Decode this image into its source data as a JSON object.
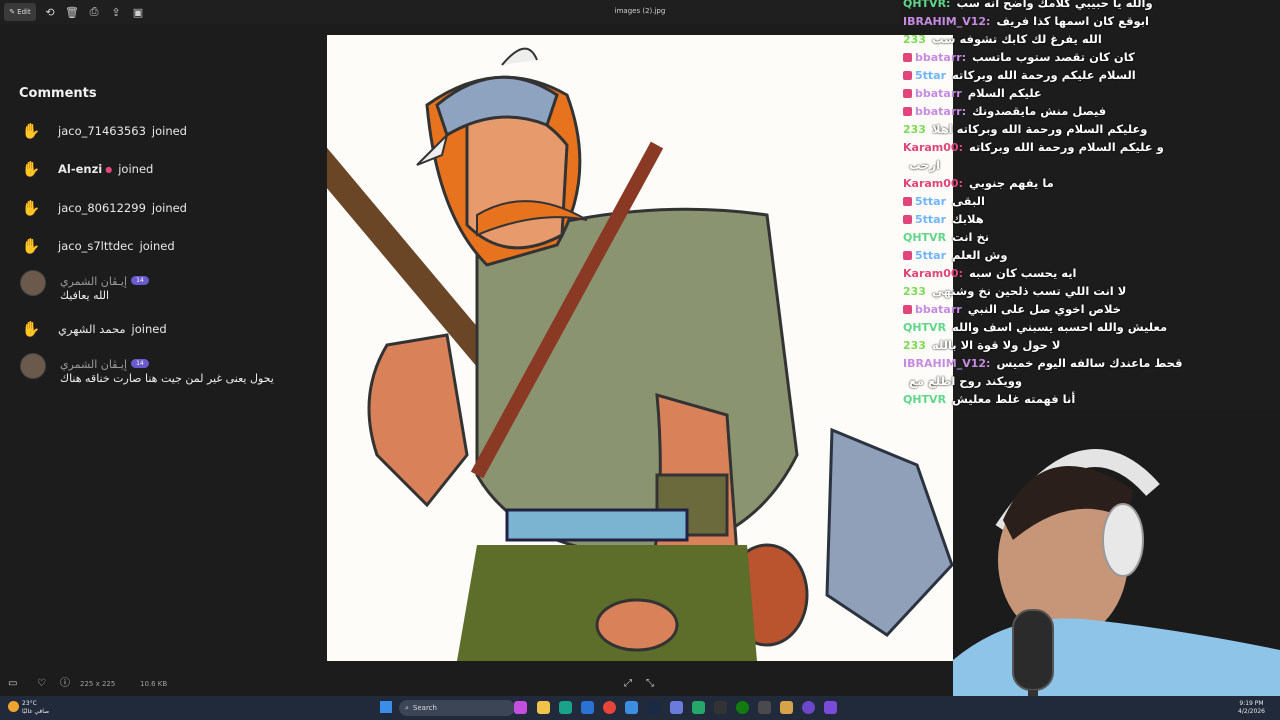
{
  "toolbar": {
    "edit_label": "Edit",
    "file_title": "images (2).jpg"
  },
  "comments": {
    "title": "Comments",
    "joins": [
      {
        "name": "jaco_71463563",
        "joined": "joined"
      },
      {
        "name": "Al-enzi",
        "joined": "joined"
      },
      {
        "name": "jaco_80612299",
        "joined": "joined"
      },
      {
        "name": "jaco_s7lttdec",
        "joined": "joined"
      }
    ],
    "messages": [
      {
        "user": "إيـڤان الشمري",
        "badge": "14",
        "text": "الله يعافيك"
      },
      {
        "user": "إيـڤان الشمري",
        "badge": "14",
        "text": "يحول يعنى غير لمن جيت هنا صارت خناقه هناك"
      }
    ],
    "join5": {
      "name": "محمد الشهري",
      "joined": "joined"
    }
  },
  "chat": [
    {
      "user": "QHTVR:",
      "color": "#5fd68a",
      "mod": false,
      "text": "والله يا حبيبي كلامك واضح انه سب"
    },
    {
      "user": "IBRAHIM_V12:",
      "color": "#c68be0",
      "mod": false,
      "text": "ابوقع كان اسمها كذا فريف"
    },
    {
      "user": "233",
      "color": "#7ed957",
      "mod": false,
      "text": "الله يفرغ لك كابك تشوفه سب"
    },
    {
      "user": "bbatarr:",
      "color": "#c68be0",
      "mod": true,
      "text": "كان كان تقصد ستوب ماتسب"
    },
    {
      "user": "5ttar",
      "color": "#6fb6ff",
      "mod": true,
      "text": "السلام عليكم ورحمة الله وبركاته"
    },
    {
      "user": "bbatarr",
      "color": "#c68be0",
      "mod": true,
      "text": "عليكم السلام"
    },
    {
      "user": "bbatarr:",
      "color": "#c68be0",
      "mod": true,
      "text": "فيصل منش مايقصدونك"
    },
    {
      "user": "233",
      "color": "#7ed957",
      "mod": false,
      "text": "وعليكم السلام ورحمة الله وبركاته اهلا"
    },
    {
      "user": "Karam00:",
      "color": "#e0457b",
      "mod": false,
      "text": "و عليكم السلام ورحمة الله وبركاته"
    },
    {
      "user": "",
      "color": "#888888",
      "mod": false,
      "text": "ارحب"
    },
    {
      "user": "Karam00:",
      "color": "#e0457b",
      "mod": false,
      "text": "ما يفهم جنوبي"
    },
    {
      "user": "5ttar",
      "color": "#6fb6ff",
      "mod": true,
      "text": "البقى"
    },
    {
      "user": "5ttar",
      "color": "#6fb6ff",
      "mod": true,
      "text": "هلابك"
    },
    {
      "user": "QHTVR",
      "color": "#5fd68a",
      "mod": false,
      "text": "نخ انت"
    },
    {
      "user": "5ttar",
      "color": "#6fb6ff",
      "mod": true,
      "text": "وش العلم"
    },
    {
      "user": "Karam00:",
      "color": "#e0457b",
      "mod": false,
      "text": "ايه يحسب كان سبه"
    },
    {
      "user": "233",
      "color": "#7ed957",
      "mod": false,
      "text": "لا انت اللي تسب ذلحين نخ وشنهي"
    },
    {
      "user": "bbatarr",
      "color": "#c68be0",
      "mod": true,
      "text": "خلاص اخوي صل على النبي"
    },
    {
      "user": "QHTVR",
      "color": "#5fd68a",
      "mod": false,
      "text": "معليش والله احسبه يسبني اسف والله"
    },
    {
      "user": "233",
      "color": "#7ed957",
      "mod": false,
      "text": "لا حول ولا قوة الا بالله"
    },
    {
      "user": "IBRAHIM_V12:",
      "color": "#c68be0",
      "mod": false,
      "text": "قحط ماعندك سالفه اليوم خميس"
    },
    {
      "user": "",
      "color": "#888888",
      "mod": false,
      "text": "وويكند روح اطلع مع"
    },
    {
      "user": "QHTVR",
      "color": "#5fd68a",
      "mod": false,
      "text": "أنا فهمته غلط معليش"
    }
  ],
  "statusbar": {
    "dimensions": "225 x 225",
    "filesize": "10.6 KB"
  },
  "taskbar": {
    "weather_temp": "23°C",
    "weather_desc": "صافي غالبًا",
    "search_placeholder": "Search",
    "time": "9:19 PM",
    "date": "4/2/2026"
  }
}
